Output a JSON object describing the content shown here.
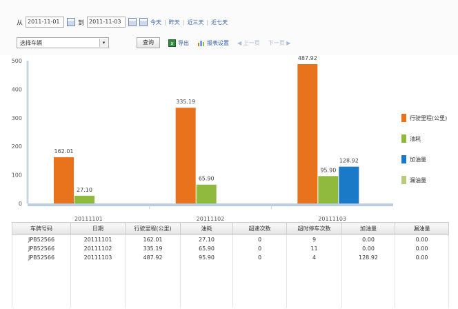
{
  "toolbar": {
    "from_label": "从",
    "start_date": "2011-11-01",
    "to_label": "到",
    "end_date": "2011-11-03",
    "quick_links": [
      "今天",
      "昨天",
      "近三天",
      "近七天"
    ],
    "vehicle_select": "选择车辆",
    "query_button": "查询",
    "export_label": "导出",
    "report_settings_label": "报表设置",
    "prev_page": "上一页",
    "next_page": "下一页"
  },
  "chart_data": {
    "type": "bar",
    "categories": [
      "20111101",
      "20111102",
      "20111103"
    ],
    "ylim": [
      0,
      500
    ],
    "yticks": [
      0,
      100,
      200,
      300,
      400,
      500
    ],
    "series": [
      {
        "name": "行驶里程(公里)",
        "color": "#e8731c",
        "values": [
          162.01,
          335.19,
          487.92
        ]
      },
      {
        "name": "油耗",
        "color": "#8fba3e",
        "values": [
          27.1,
          65.9,
          95.9
        ]
      },
      {
        "name": "加油量",
        "color": "#1a7ac8",
        "values": [
          0,
          0,
          128.92
        ]
      },
      {
        "name": "漏油量",
        "color": "#b9c97d",
        "values": [
          0,
          0,
          0
        ]
      }
    ],
    "data_labels": [
      [
        "162.01",
        "335.19",
        "487.92"
      ],
      [
        "27.10",
        "65.90",
        "95.90"
      ],
      [
        "",
        "",
        "128.92"
      ],
      [
        "",
        "",
        ""
      ]
    ],
    "legend_position": "right"
  },
  "table": {
    "headers": [
      "车牌号码",
      "日期",
      "行驶里程(公里)",
      "油耗",
      "超速次数",
      "超时停车次数",
      "加油量",
      "漏油量"
    ],
    "rows": [
      [
        "JPB52566",
        "20111101",
        "162.01",
        "27.10",
        "0",
        "9",
        "0.00",
        "0.00"
      ],
      [
        "JPB52566",
        "20111102",
        "335.19",
        "65.90",
        "0",
        "11",
        "0.00",
        "0.00"
      ],
      [
        "JPB52566",
        "20111103",
        "487.92",
        "95.90",
        "0",
        "4",
        "128.92",
        "0.00"
      ]
    ]
  }
}
